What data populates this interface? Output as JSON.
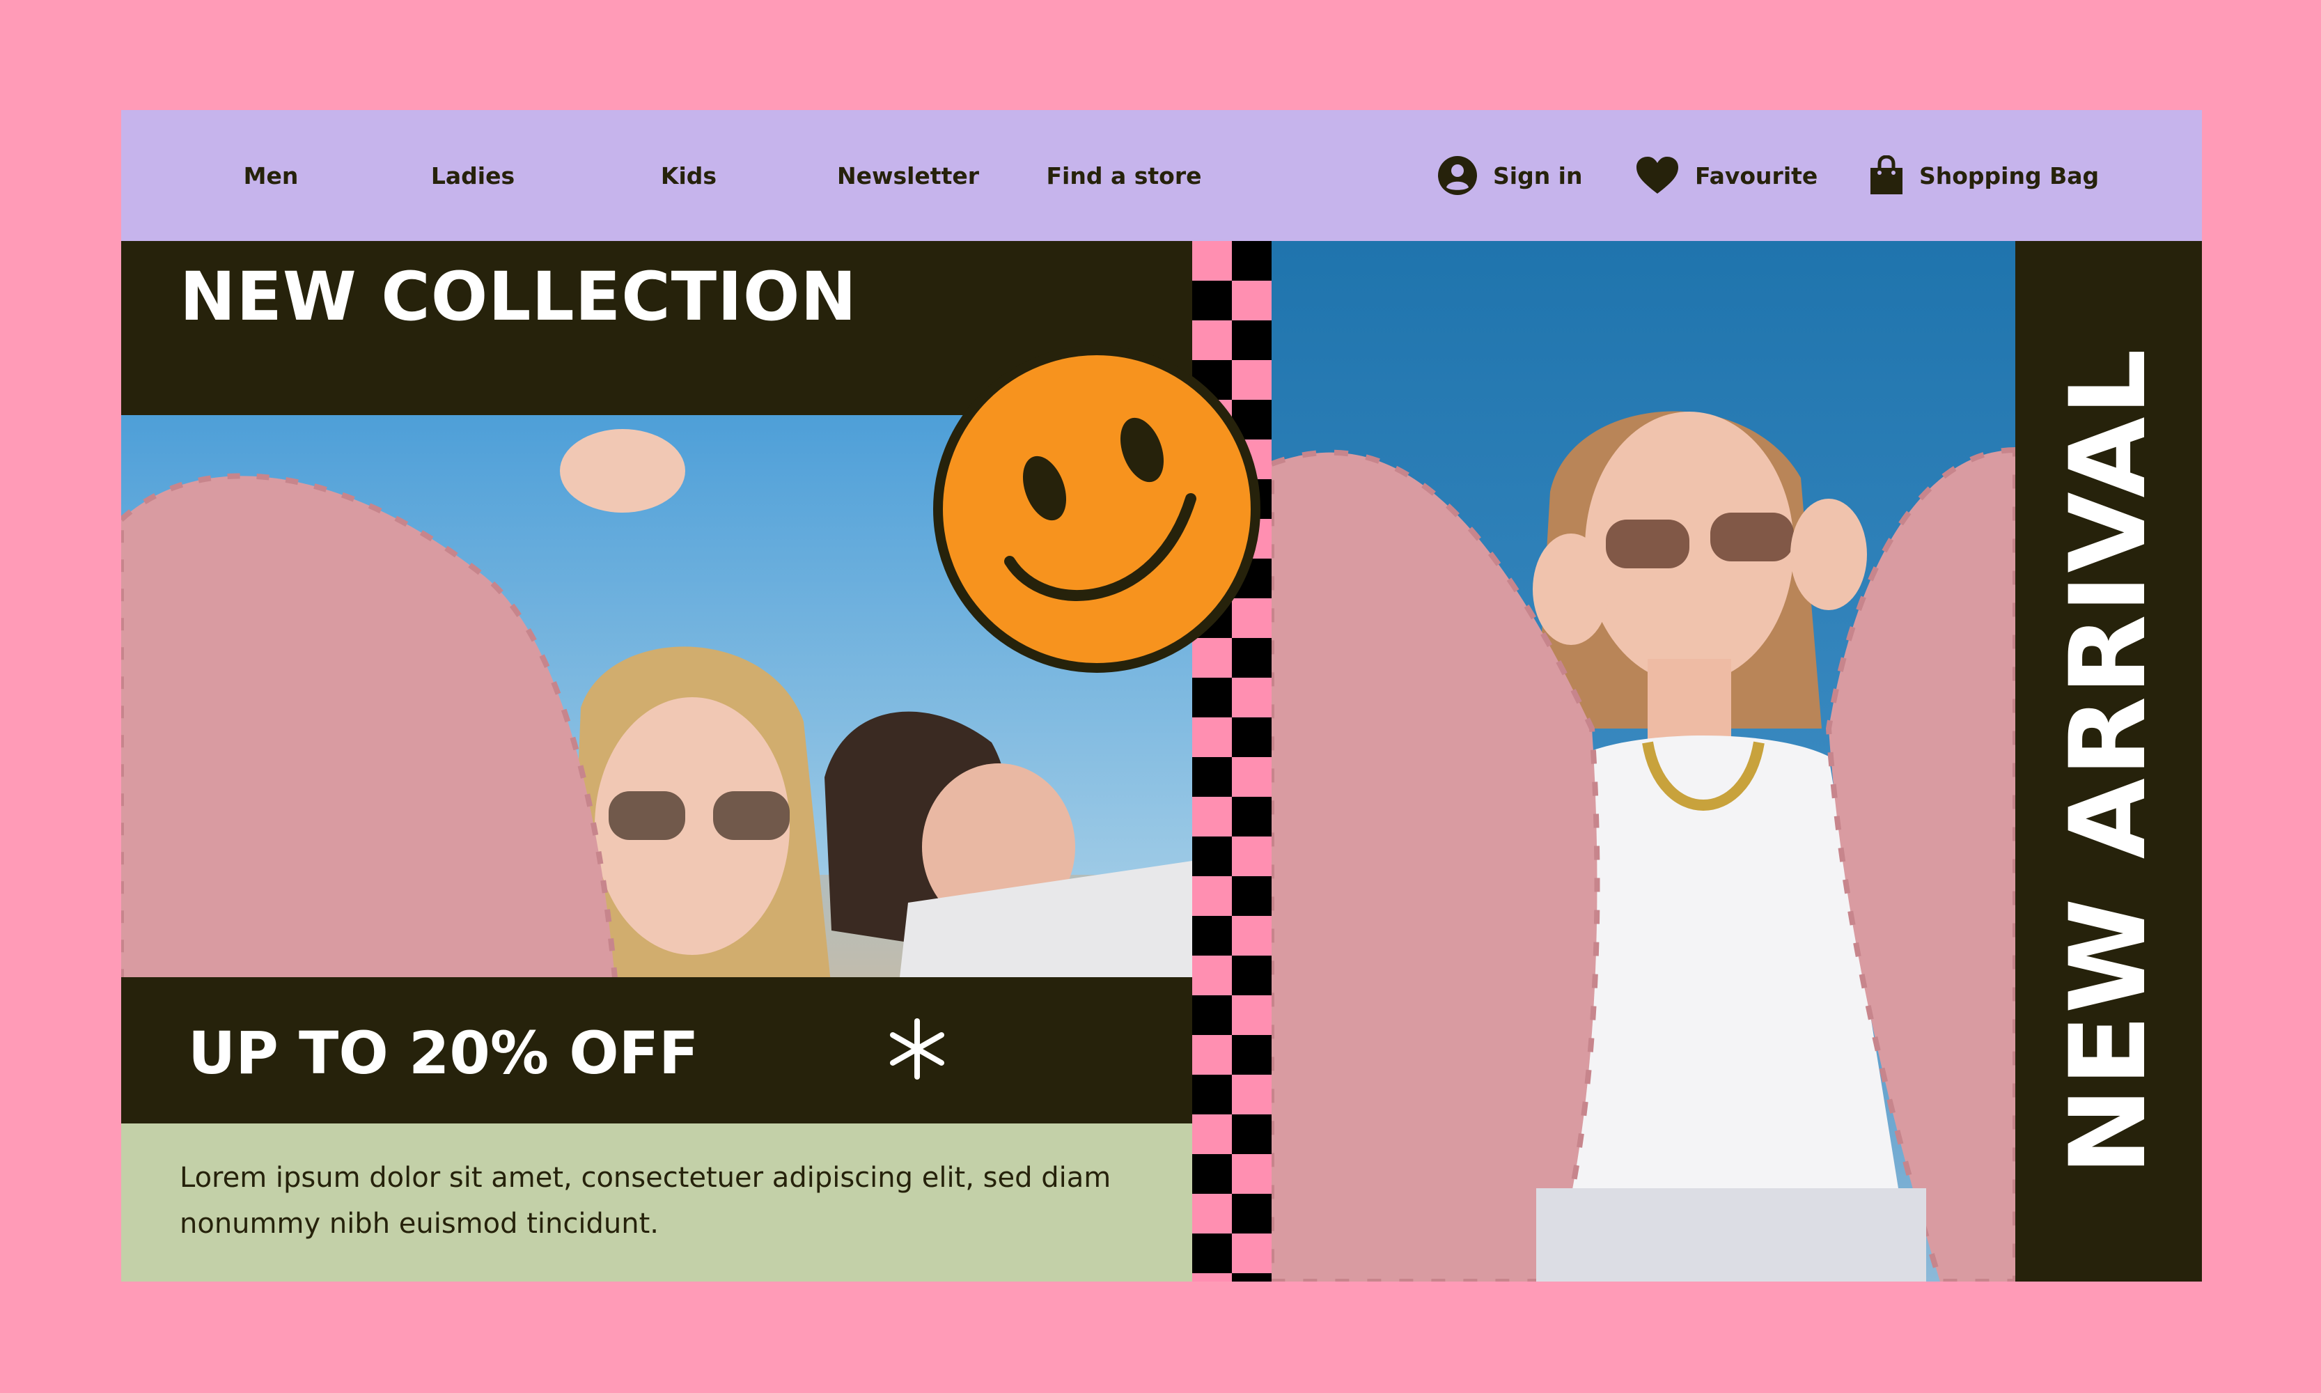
{
  "nav": {
    "links": [
      {
        "label": "Men"
      },
      {
        "label": "Ladies"
      },
      {
        "label": "Kids"
      },
      {
        "label": "Newsletter"
      },
      {
        "label": "Find a store"
      }
    ],
    "actions": [
      {
        "label": "Sign in",
        "icon": "user-icon"
      },
      {
        "label": "Favourite",
        "icon": "heart-icon"
      },
      {
        "label": "Shopping Bag",
        "icon": "shopping-bag-icon"
      }
    ]
  },
  "hero": {
    "title": "NEW COLLECTION",
    "promo": "UP TO 20% OFF",
    "description": "Lorem ipsum dolor sit amet, consectetuer adipiscing elit, sed diam nonummy nibh euismod tincidunt.",
    "side_label": "NEW ARRIVAL"
  },
  "colors": {
    "background": "#ff9bb7",
    "nav": "#c6b4ec",
    "dark": "#26220b",
    "description_band": "#c3d0a8",
    "checker_pink": "#ff8fb1",
    "smiley": "#f7931e"
  }
}
